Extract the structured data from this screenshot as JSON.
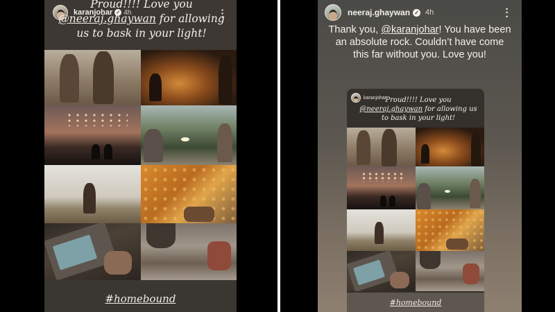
{
  "left_story": {
    "user": {
      "username": "karanjohar",
      "time": "4h"
    },
    "caption": {
      "before": "Proud!!!! Love you",
      "mention": "@neeraj.ghaywan",
      "after": " for allowing us to bask in your light!"
    },
    "photos": [
      {
        "scene": "sitting"
      },
      {
        "scene": "sunset-figure"
      },
      {
        "scene": "fireworks"
      },
      {
        "scene": "road"
      },
      {
        "scene": "field"
      },
      {
        "scene": "cloth"
      },
      {
        "scene": "phone"
      },
      {
        "scene": "ruins"
      }
    ],
    "hashtag": "#homebound"
  },
  "right_story": {
    "user": {
      "username": "neeraj.ghaywan",
      "time": "4h"
    },
    "reply": {
      "before": "Thank you, ",
      "mention": "@karanjohar",
      "after": "! You have been an absolute rock. Couldn’t have come this far without you. Love you!"
    },
    "shared_post": {
      "username": "karanjohar",
      "caption_before": "Proud!!!! Love you",
      "caption_mention": "@neeraj.ghaywan",
      "caption_after": " for allowing us to bask in your light!",
      "hashtag": "#homebound"
    }
  },
  "icons": {
    "verified": "verified-badge-icon",
    "menu": "more-options-icon"
  },
  "colors": {
    "left_background": "#3a3631",
    "right_gradient_top": "#4a4a46",
    "right_gradient_bottom": "#8e8071",
    "text": "#f4f1ec"
  }
}
